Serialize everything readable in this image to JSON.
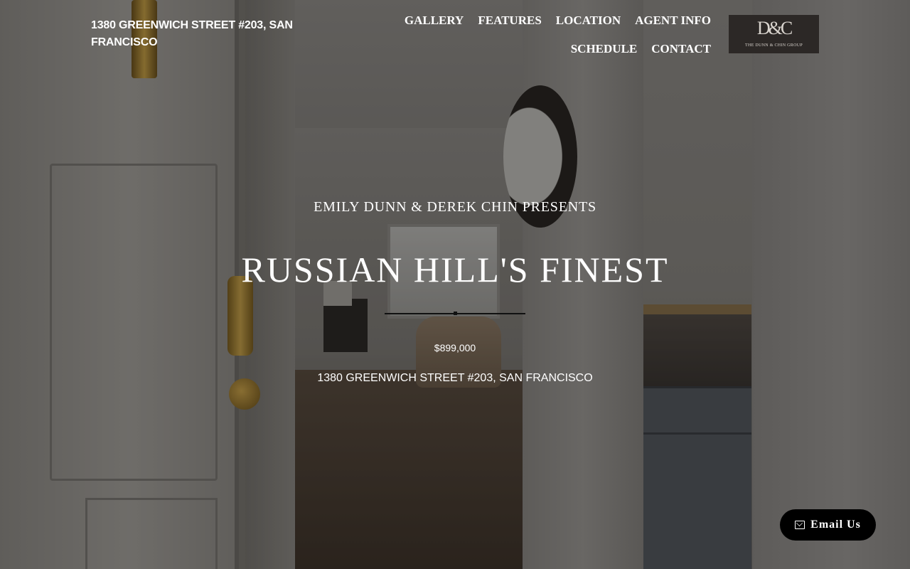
{
  "header": {
    "address": "1380 GREENWICH STREET #203, SAN FRANCISCO",
    "nav": [
      {
        "label": "GALLERY"
      },
      {
        "label": "FEATURES"
      },
      {
        "label": "LOCATION"
      },
      {
        "label": "AGENT INFO"
      },
      {
        "label": "SCHEDULE"
      },
      {
        "label": "CONTACT"
      }
    ],
    "logo": {
      "mark": "D&C",
      "name": "THE DUNN & CHIN GROUP"
    }
  },
  "hero": {
    "presents": "EMILY DUNN & DEREK CHIN PRESENTS",
    "headline": "RUSSIAN HILL'S FINEST",
    "price": "$899,000",
    "address": "1380 GREENWICH STREET #203, SAN FRANCISCO"
  },
  "email_button": {
    "label": "Email Us",
    "icon": "envelope-icon"
  }
}
